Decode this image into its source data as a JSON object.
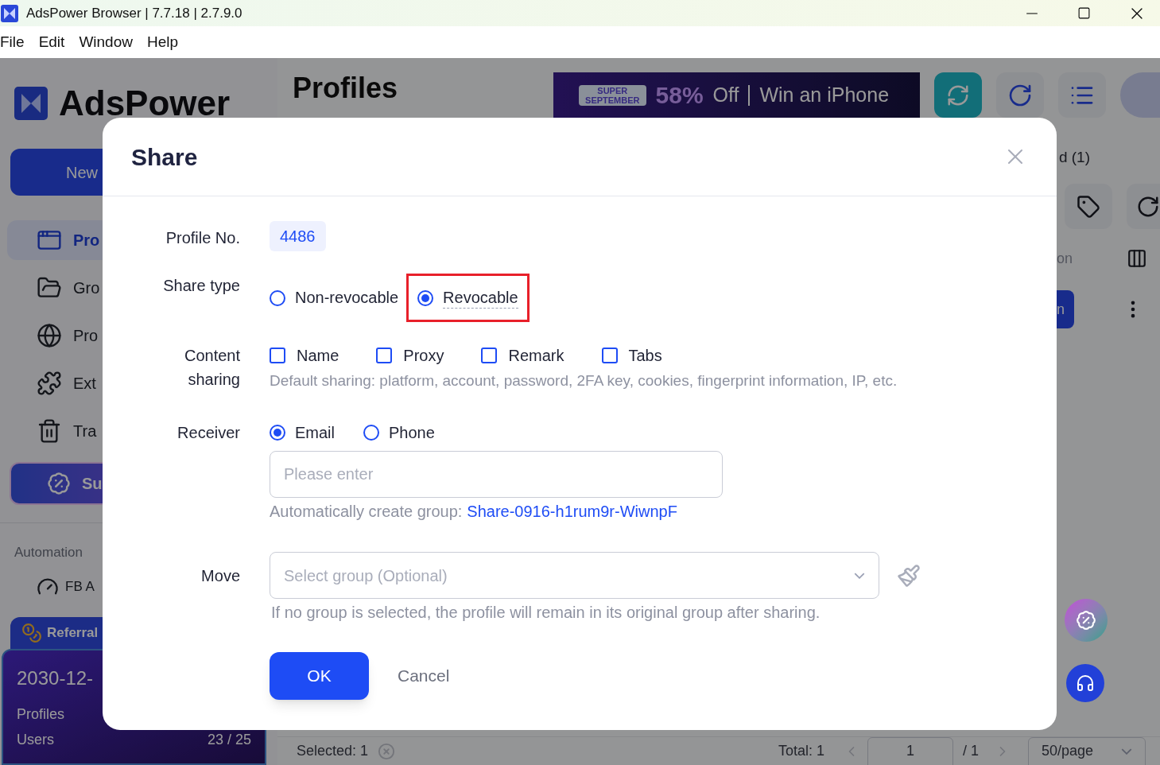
{
  "window": {
    "title": "AdsPower Browser | 7.7.18 | 2.7.9.0"
  },
  "menu": [
    "File",
    "Edit",
    "Window",
    "Help"
  ],
  "sidebar": {
    "logo": "AdsPower",
    "new_button": "New",
    "items": [
      {
        "label": "Pro",
        "selected": true
      },
      {
        "label": "Gro",
        "selected": false
      },
      {
        "label": "Pro",
        "selected": false
      },
      {
        "label": "Ext",
        "selected": false
      },
      {
        "label": "Tra",
        "selected": false
      }
    ],
    "promo_button": "Su",
    "section": "Automation",
    "automation_item": "FB A",
    "referral": {
      "tab": "Referral",
      "date": "2030-12-",
      "rows": [
        {
          "label": "Profiles"
        },
        {
          "label": "Users",
          "value": "23 / 25"
        }
      ]
    }
  },
  "main": {
    "title": "Profiles",
    "banner": {
      "badge_top": "SUPER",
      "badge_bottom": "SEPTEMBER",
      "discount": "58%",
      "off": "Off",
      "promo": "Win an iPhone"
    },
    "tab_fragment": "d (1)",
    "column_fragment": "on",
    "button_fragment": "n",
    "footer": {
      "selected": "Selected: 1",
      "total": "Total: 1",
      "page": "1",
      "pages": "/ 1",
      "page_size": "50/page"
    }
  },
  "dialog": {
    "title": "Share",
    "fields": [
      {
        "kind": "badge",
        "label": "Profile No.",
        "value": "4486"
      },
      {
        "kind": "radio",
        "label": "Share type",
        "options": [
          {
            "label": "Non-revocable",
            "selected": false,
            "highlighted": false,
            "has_tooltip": false
          },
          {
            "label": "Revocable",
            "selected": true,
            "highlighted": true,
            "has_tooltip": true
          }
        ]
      },
      {
        "kind": "checkbox",
        "label": "Content sharing",
        "options": [
          {
            "label": "Name",
            "checked": false
          },
          {
            "label": "Proxy",
            "checked": false
          },
          {
            "label": "Remark",
            "checked": false
          },
          {
            "label": "Tabs",
            "checked": false
          }
        ],
        "hint": "Default sharing: platform, account, password, 2FA key, cookies, fingerprint information, IP, etc."
      },
      {
        "kind": "receiver",
        "label": "Receiver",
        "options": [
          {
            "label": "Email",
            "selected": true
          },
          {
            "label": "Phone",
            "selected": false
          }
        ],
        "placeholder": "Please enter",
        "note": "Automatically create group:",
        "link": "Share-0916-h1rum9r-WiwnpF"
      },
      {
        "kind": "select",
        "label": "Move",
        "placeholder": "Select group (Optional)",
        "hint": "If no group is selected, the profile will remain in its original group after sharing."
      }
    ],
    "ok": "OK",
    "cancel": "Cancel"
  }
}
